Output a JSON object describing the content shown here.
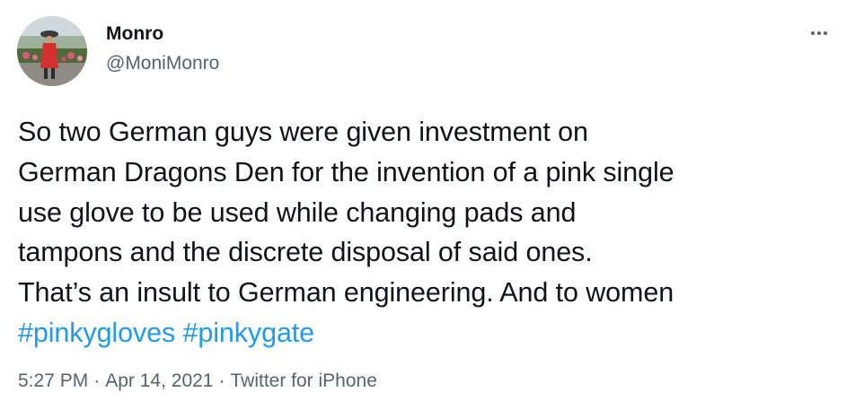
{
  "colors": {
    "text": "#0f1419",
    "secondary": "#536471",
    "accent": "#1d9bf0"
  },
  "author": {
    "display_name": "Monro",
    "handle": "@MoniMonro",
    "avatar_icon": "avatar-photo"
  },
  "menu": {
    "icon": "more-horizontal-icon"
  },
  "tweet": {
    "text": "So two German guys were given investment on\nGerman Dragons Den for the invention of a pink single\nuse glove to be used while changing pads and\ntampons and the discrete disposal of said ones.\nThat’s an insult to German engineering. And to women\n",
    "hashtags": [
      "#pinkygloves",
      "#pinkygate"
    ]
  },
  "meta": {
    "time": "5:27 PM",
    "separator": "·",
    "date": "Apr 14, 2021",
    "source": "Twitter for iPhone"
  }
}
